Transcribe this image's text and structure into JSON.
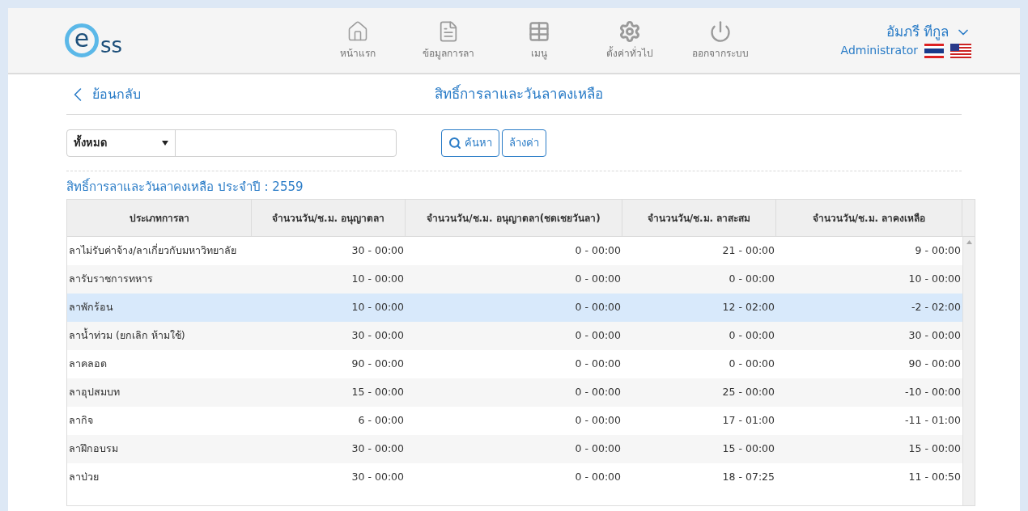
{
  "logo": {
    "letter": "e",
    "rest": "ss"
  },
  "nav": [
    {
      "label": "หน้าแรก"
    },
    {
      "label": "ข้อมูลการลา"
    },
    {
      "label": "เมนู"
    },
    {
      "label": "ตั้งค่าทั่วไป"
    },
    {
      "label": "ออกจากระบบ"
    }
  ],
  "user": {
    "name": "อัมภรี ทีกูล",
    "role": "Administrator"
  },
  "back": {
    "label": "ย้อนกลับ"
  },
  "page_title": "สิทธิ์การลาและวันลาคงเหลือ",
  "filter": {
    "select_value": "ทั้งหมด",
    "search_button": "ค้นหา",
    "clear_button": "ล้างค่า"
  },
  "section_title": "สิทธิ์การลาและวันลาคงเหลือ ประจำปี : 2559",
  "table": {
    "columns": [
      "ประเภทการลา",
      "จำนวนวัน/ช.ม. อนุญาตลา",
      "จำนวนวัน/ช.ม. อนุญาตลา(ชดเชยวันลา)",
      "จำนวนวัน/ช.ม. ลาสะสม",
      "จำนวนวัน/ช.ม. ลาคงเหลือ"
    ],
    "rows": [
      {
        "selected": false,
        "cells": [
          "ลาไม่รับค่าจ้าง/ลาเกี่ยวกับมหาวิทยาลัย",
          "30 - 00:00",
          "0 - 00:00",
          "21 - 00:00",
          "9 - 00:00"
        ]
      },
      {
        "selected": false,
        "cells": [
          "ลารับราชการทหาร",
          "10 - 00:00",
          "0 - 00:00",
          "0 - 00:00",
          "10 - 00:00"
        ]
      },
      {
        "selected": true,
        "cells": [
          "ลาพักร้อน",
          "10 - 00:00",
          "0 - 00:00",
          "12 - 02:00",
          "-2 - 02:00"
        ]
      },
      {
        "selected": false,
        "cells": [
          "ลาน้ำท่วม (ยกเลิก ห้ามใช้)",
          "30 - 00:00",
          "0 - 00:00",
          "0 - 00:00",
          "30 - 00:00"
        ]
      },
      {
        "selected": false,
        "cells": [
          "ลาคลอด",
          "90 - 00:00",
          "0 - 00:00",
          "0 - 00:00",
          "90 - 00:00"
        ]
      },
      {
        "selected": false,
        "cells": [
          "ลาอุปสมบท",
          "15 - 00:00",
          "0 - 00:00",
          "25 - 00:00",
          "-10 - 00:00"
        ]
      },
      {
        "selected": false,
        "cells": [
          "ลากิจ",
          "6 - 00:00",
          "0 - 00:00",
          "17 - 01:00",
          "-11 - 01:00"
        ]
      },
      {
        "selected": false,
        "cells": [
          "ลาฝึกอบรม",
          "30 - 00:00",
          "0 - 00:00",
          "15 - 00:00",
          "15 - 00:00"
        ]
      },
      {
        "selected": false,
        "cells": [
          "ลาป่วย",
          "30 - 00:00",
          "0 - 00:00",
          "18 - 07:25",
          "11 - 00:50"
        ]
      }
    ]
  }
}
